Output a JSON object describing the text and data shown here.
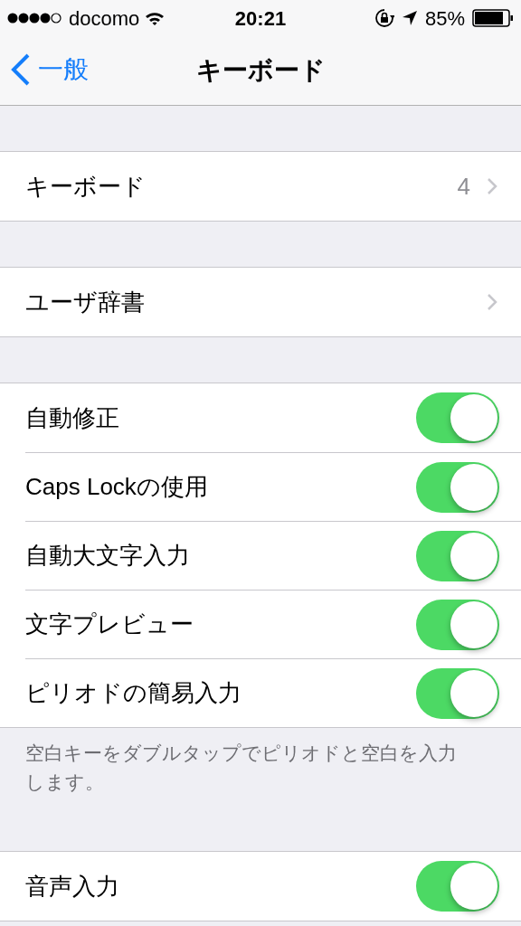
{
  "status_bar": {
    "carrier": "docomo",
    "time": "20:21",
    "battery": "85%"
  },
  "nav": {
    "back": "一般",
    "title": "キーボード"
  },
  "sections": [
    {
      "rows": [
        {
          "kind": "link",
          "label": "キーボード",
          "value": "4"
        }
      ]
    },
    {
      "rows": [
        {
          "kind": "link",
          "label": "ユーザ辞書"
        }
      ]
    },
    {
      "rows": [
        {
          "kind": "toggle",
          "label": "自動修正",
          "on": true
        },
        {
          "kind": "toggle",
          "label": "Caps Lockの使用",
          "on": true
        },
        {
          "kind": "toggle",
          "label": "自動大文字入力",
          "on": true
        },
        {
          "kind": "toggle",
          "label": "文字プレビュー",
          "on": true
        },
        {
          "kind": "toggle",
          "label": "ピリオドの簡易入力",
          "on": true
        }
      ],
      "footer": "空白キーをダブルタップでピリオドと空白を入力します。"
    },
    {
      "rows": [
        {
          "kind": "toggle",
          "label": "音声入力",
          "on": true
        }
      ]
    }
  ]
}
